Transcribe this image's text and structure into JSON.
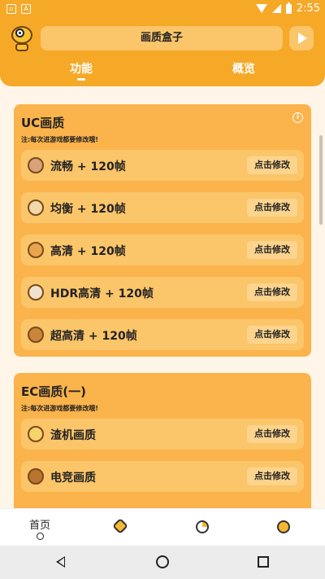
{
  "status_bar": {
    "time": "2:55"
  },
  "header": {
    "title": "画质盒子",
    "tabs": [
      {
        "label": "功能",
        "selected": true
      },
      {
        "label": "概览",
        "selected": false
      }
    ]
  },
  "sections": [
    {
      "title": "UC画质",
      "note": "注:每次进游戏都要修改哦!",
      "rows": [
        {
          "icon": "mouse-icon",
          "label": "流畅 + 120帧",
          "button": "点击修改"
        },
        {
          "icon": "cow-icon",
          "label": "均衡 + 120帧",
          "button": "点击修改"
        },
        {
          "icon": "tiger-icon",
          "label": "高清 + 120帧",
          "button": "点击修改"
        },
        {
          "icon": "rabbit-icon",
          "label": "HDR高清 + 120帧",
          "button": "点击修改"
        },
        {
          "icon": "dragon-icon",
          "label": "超高清 + 120帧",
          "button": "点击修改"
        }
      ]
    },
    {
      "title": "EC画质(一)",
      "note": "注:每次进游戏都要修改哦!",
      "rows": [
        {
          "icon": "skull-icon",
          "label": "渣机画质",
          "button": "点击修改"
        },
        {
          "icon": "wolf-icon",
          "label": "电竞画质",
          "button": "点击修改"
        }
      ]
    }
  ],
  "bottom_nav": [
    {
      "label": "首页",
      "icon": "home-dot-icon",
      "selected": true
    },
    {
      "label": "",
      "icon": "shield-check-icon",
      "selected": false
    },
    {
      "label": "",
      "icon": "pie-chart-icon",
      "selected": false
    },
    {
      "label": "",
      "icon": "user-icon",
      "selected": false
    }
  ],
  "colors": {
    "accent": "#F6A827",
    "card": "#FBB34B",
    "row": "#FBC56A",
    "background": "#FFF6E9"
  }
}
